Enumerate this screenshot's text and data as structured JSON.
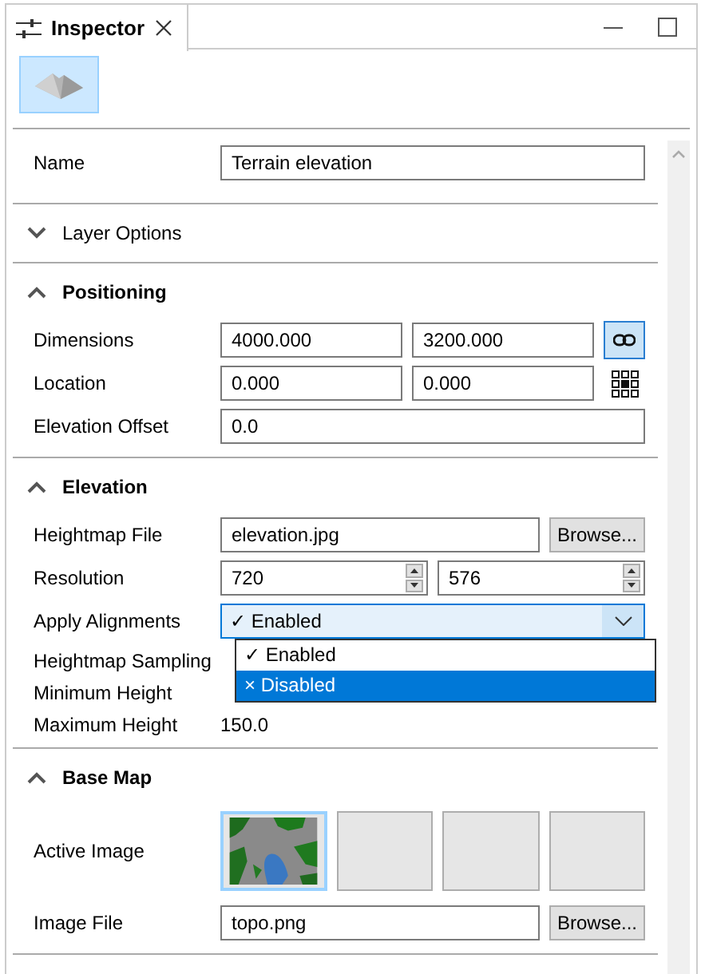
{
  "tab": {
    "title": "Inspector",
    "selected": true
  },
  "layer_type_button": {
    "selected": true
  },
  "name_field": {
    "label": "Name",
    "value": "Terrain elevation"
  },
  "sections": [
    {
      "title": "Layer Options",
      "expanded": false
    },
    {
      "title": "Positioning",
      "expanded": true,
      "rows": [
        {
          "kind": "pair",
          "label": "Dimensions",
          "values": [
            "4000.000",
            "3200.000"
          ],
          "trailing": {
            "kind": "link",
            "selected": true
          }
        },
        {
          "kind": "pair",
          "label": "Location",
          "values": [
            "0.000",
            "0.000"
          ],
          "trailing": {
            "kind": "anchor"
          }
        },
        {
          "kind": "text",
          "label": "Elevation Offset",
          "value": "0.0"
        }
      ]
    },
    {
      "title": "Elevation",
      "expanded": true,
      "rows": [
        {
          "kind": "file",
          "label": "Heightmap File",
          "value": "elevation.jpg",
          "button": "Browse..."
        },
        {
          "kind": "spin_pair",
          "label": "Resolution",
          "values": [
            "720",
            "576"
          ]
        },
        {
          "kind": "combo",
          "label": "Apply Alignments",
          "value": "✓ Enabled",
          "open": true,
          "options": [
            {
              "label": "✓ Enabled",
              "highlighted": false
            },
            {
              "label": "× Disabled",
              "highlighted": true
            }
          ]
        },
        {
          "kind": "readonly",
          "label": "Heightmap Sampling"
        },
        {
          "kind": "readonly",
          "label": "Minimum Height"
        },
        {
          "kind": "readonly",
          "label": "Maximum Height",
          "value": "150.0"
        }
      ]
    },
    {
      "title": "Base Map",
      "expanded": true,
      "rows": [
        {
          "kind": "images",
          "label": "Active Image",
          "thumbnails": [
            {
              "kind": "picture",
              "selected": true
            },
            {
              "kind": "empty",
              "selected": false
            },
            {
              "kind": "empty",
              "selected": false
            },
            {
              "kind": "empty",
              "selected": false
            }
          ]
        },
        {
          "kind": "file",
          "label": "Image File",
          "value": "topo.png",
          "button": "Browse..."
        }
      ]
    }
  ]
}
